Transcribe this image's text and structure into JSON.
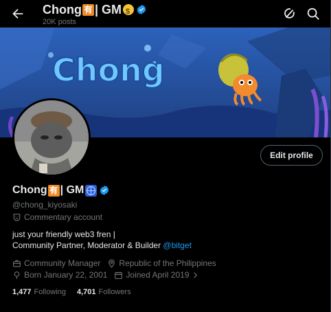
{
  "header": {
    "name_part1": "Chong",
    "name_cjk": "有",
    "name_part2": "| GM",
    "post_count": "20K posts"
  },
  "banner": {
    "text": "Chong"
  },
  "profile": {
    "name_part1": "Chong",
    "name_cjk": "有",
    "name_part2": "| GM",
    "handle": "@chong_kiyosaki",
    "category": "Commentary account",
    "bio_line1": "just your friendly web3 fren |",
    "bio_line2_prefix": "Community Partner, Moderator & Builder ",
    "bio_link": "@bitget",
    "job": "Community Manager",
    "location": "Republic of the Philippines",
    "born": "Born January 22, 2001",
    "joined": "Joined April 2019"
  },
  "actions": {
    "edit_profile": "Edit profile"
  },
  "stats": {
    "following_count": "1,477",
    "following_label": "Following",
    "followers_count": "4,701",
    "followers_label": "Followers"
  },
  "colors": {
    "accent": "#1d9bf0",
    "muted": "#71767b",
    "background": "#000000"
  },
  "icons": [
    "back-arrow-icon",
    "verified-badge-icon",
    "grok-icon",
    "search-icon",
    "category-icon",
    "briefcase-icon",
    "location-icon",
    "birthday-icon",
    "calendar-icon",
    "chevron-right-icon"
  ]
}
